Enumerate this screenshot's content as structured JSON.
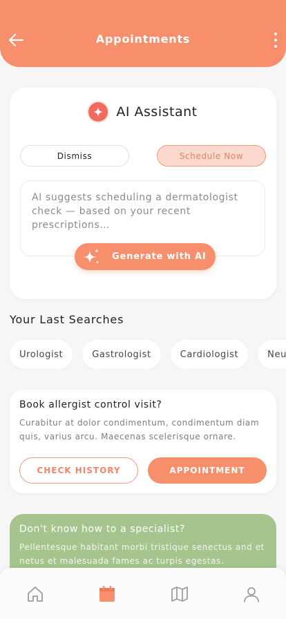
{
  "header": {
    "title": "Appointments",
    "back_icon": "arrow-left-icon",
    "menu_icon": "more-vertical-icon"
  },
  "ai_card": {
    "icon": "sparkle-badge-icon",
    "title": "AI Assistant",
    "dismiss_label": "Dismiss",
    "schedule_label": "Schedule Now",
    "suggestion": "AI suggests scheduling a dermatologist check — based on your recent prescriptions…",
    "generate_icon": "sparkles-icon",
    "generate_label": "Generate with AI"
  },
  "last_searches": {
    "title": "Your Last Searches",
    "chips": [
      "Urologist",
      "Gastrologist",
      "Cardiologist",
      "Neurologist"
    ]
  },
  "book_card": {
    "title": "Book allergist control visit?",
    "description": "Curabitur at dolor condimentum, condimentum diam quis, varius arcu. Maecenas scelerisque ornare.",
    "secondary_label": "CHECK HISTORY",
    "primary_label": "APPOINTMENT"
  },
  "info_card": {
    "title": "Don't know how to a specialist?",
    "description": "Pellentesque habitant morbi tristique senectus and et netus et malesuada fames ac turpis egestas."
  },
  "bottom_nav": {
    "items": [
      {
        "icon": "home-icon",
        "active": false
      },
      {
        "icon": "calendar-icon",
        "active": true
      },
      {
        "icon": "map-icon",
        "active": false
      },
      {
        "icon": "profile-icon",
        "active": false
      }
    ]
  },
  "colors": {
    "accent": "#f78f6d",
    "accent_light": "#fcd9cc",
    "green": "#a5c48e",
    "background": "#f6f6f6",
    "nav_inactive": "#9a9a9a"
  }
}
